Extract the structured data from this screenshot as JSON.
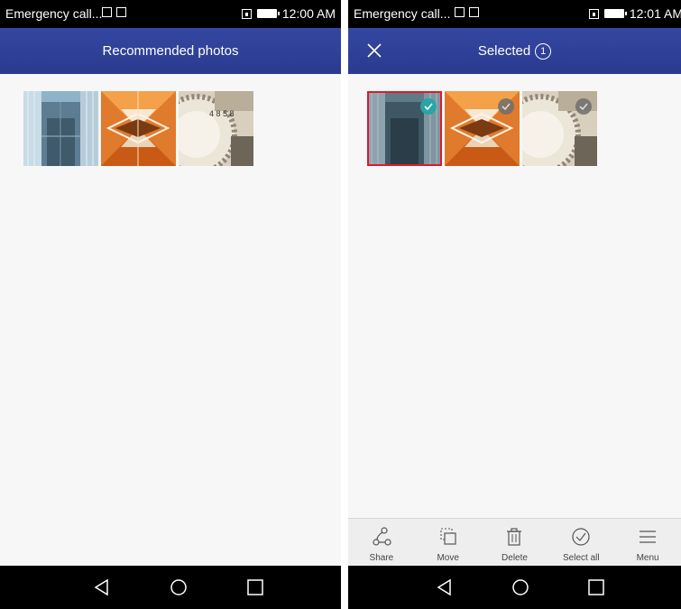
{
  "left": {
    "status": {
      "title": "Emergency call...",
      "time": "12:00 AM"
    },
    "header": {
      "title": "Recommended photos"
    },
    "photos": [
      {
        "name": "building-glass-photo"
      },
      {
        "name": "orange-geometric-photo"
      },
      {
        "name": "dial-closeup-photo"
      }
    ],
    "nav": [
      "back-icon",
      "home-icon",
      "recents-icon"
    ]
  },
  "right": {
    "status": {
      "title": "Emergency call...",
      "time": "12:01 AM"
    },
    "header": {
      "title": "Selected",
      "count": "1"
    },
    "photos": [
      {
        "name": "building-glass-photo",
        "selected": true
      },
      {
        "name": "orange-geometric-photo",
        "selected": false
      },
      {
        "name": "dial-closeup-photo",
        "selected": false
      }
    ],
    "toolbar": {
      "share": "Share",
      "move": "Move",
      "delete": "Delete",
      "select_all": "Select all",
      "menu": "Menu"
    }
  },
  "colors": {
    "header": "#2f3f98",
    "check_selected": "#2aa4a4",
    "selected_border": "#e0192b"
  }
}
